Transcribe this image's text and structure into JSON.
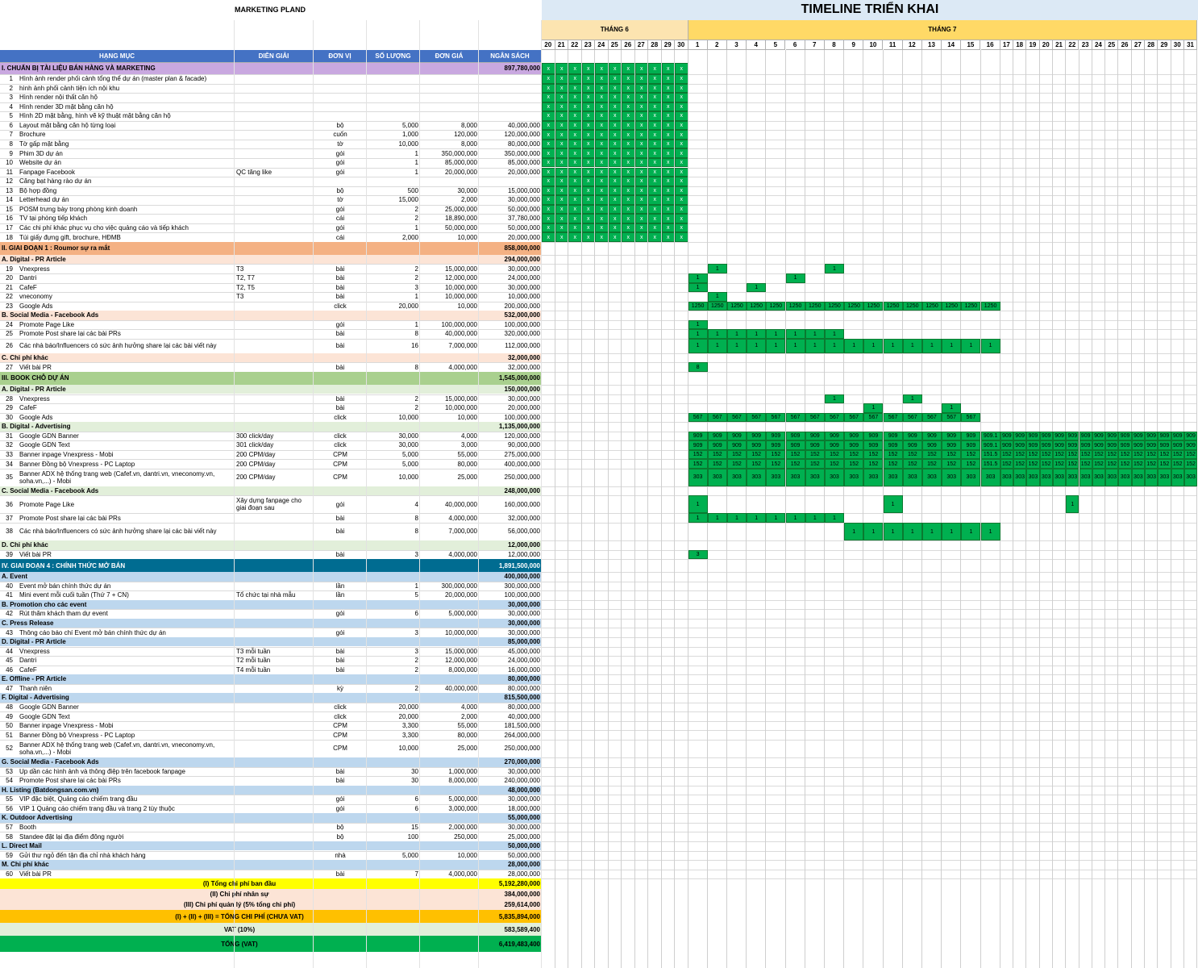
{
  "title": "MARKETING PLAND",
  "timeline_title": "TIMELINE TRIỂN KHAI",
  "months": [
    "THÁNG 6",
    "THÁNG 7"
  ],
  "june_days": [
    "20",
    "21",
    "22",
    "23",
    "24",
    "25",
    "26",
    "27",
    "28",
    "29",
    "30"
  ],
  "july_days": [
    "1",
    "2",
    "3",
    "4",
    "5",
    "6",
    "7",
    "8",
    "9",
    "10",
    "11",
    "12",
    "13",
    "14",
    "15",
    "16",
    "17",
    "18",
    "19",
    "20",
    "21",
    "22",
    "23",
    "24",
    "25",
    "26",
    "27",
    "28",
    "29",
    "30",
    "31"
  ],
  "columns": [
    "HẠNG MỤC",
    "DIỄN GIẢI",
    "ĐƠN VỊ",
    "SỐ LƯỢNG",
    "ĐƠN GIÁ",
    "NGÂN SÁCH"
  ],
  "rows": [
    {
      "t": "sec",
      "label": "I. CHUẨN BỊ TÀI LIỆU BÁN HÀNG VÀ MARKETING",
      "total": "897,780,000",
      "bg": "#c9a8e0"
    },
    {
      "t": "item",
      "no": "1",
      "name": "Hình ảnh render phối cảnh tổng thể dự án (master plan & facade)",
      "desc": "",
      "unit": "",
      "qty": "",
      "price": "",
      "total": ""
    },
    {
      "t": "item",
      "no": "2",
      "name": "hình ảnh phối cảnh tiện ích nội khu",
      "desc": "",
      "unit": "",
      "qty": "",
      "price": "",
      "total": ""
    },
    {
      "t": "item",
      "no": "3",
      "name": "Hình render nội thất căn hộ",
      "desc": "",
      "unit": "",
      "qty": "",
      "price": "",
      "total": ""
    },
    {
      "t": "item",
      "no": "4",
      "name": "Hình render 3D mặt bằng căn hộ",
      "desc": "",
      "unit": "",
      "qty": "",
      "price": "",
      "total": ""
    },
    {
      "t": "item",
      "no": "5",
      "name": "Hình 2D mặt bằng, hình vẽ kỹ thuật mặt bằng căn hộ",
      "desc": "",
      "unit": "",
      "qty": "",
      "price": "",
      "total": ""
    },
    {
      "t": "item",
      "no": "6",
      "name": "Layout mặt bằng căn hộ từng loại",
      "desc": "",
      "unit": "bộ",
      "qty": "5,000",
      "price": "8,000",
      "total": "40,000,000"
    },
    {
      "t": "item",
      "no": "7",
      "name": "Brochure",
      "desc": "",
      "unit": "cuốn",
      "qty": "1,000",
      "price": "120,000",
      "total": "120,000,000"
    },
    {
      "t": "item",
      "no": "8",
      "name": "Tờ gấp mặt bằng",
      "desc": "",
      "unit": "tờ",
      "qty": "10,000",
      "price": "8,000",
      "total": "80,000,000"
    },
    {
      "t": "item",
      "no": "9",
      "name": "Phim 3D dự án",
      "desc": "",
      "unit": "gói",
      "qty": "1",
      "price": "350,000,000",
      "total": "350,000,000"
    },
    {
      "t": "item",
      "no": "10",
      "name": "Website dự án",
      "desc": "",
      "unit": "gói",
      "qty": "1",
      "price": "85,000,000",
      "total": "85,000,000"
    },
    {
      "t": "item",
      "no": "11",
      "name": "Fanpage Facebook",
      "desc": "QC tăng like",
      "unit": "gói",
      "qty": "1",
      "price": "20,000,000",
      "total": "20,000,000"
    },
    {
      "t": "item",
      "no": "12",
      "name": "Căng bạt hàng rào dự án",
      "desc": "",
      "unit": "",
      "qty": "",
      "price": "",
      "total": ""
    },
    {
      "t": "item",
      "no": "13",
      "name": "Bộ hợp đồng",
      "desc": "",
      "unit": "bộ",
      "qty": "500",
      "price": "30,000",
      "total": "15,000,000"
    },
    {
      "t": "item",
      "no": "14",
      "name": "Letterhead dự án",
      "desc": "",
      "unit": "tờ",
      "qty": "15,000",
      "price": "2,000",
      "total": "30,000,000"
    },
    {
      "t": "item",
      "no": "15",
      "name": "POSM trưng bày trong phòng kinh doanh",
      "desc": "",
      "unit": "gói",
      "qty": "2",
      "price": "25,000,000",
      "total": "50,000,000"
    },
    {
      "t": "item",
      "no": "16",
      "name": "TV tại phòng tiếp khách",
      "desc": "",
      "unit": "cái",
      "qty": "2",
      "price": "18,890,000",
      "total": "37,780,000"
    },
    {
      "t": "item",
      "no": "17",
      "name": "Các chi phí khác phục vụ cho việc quảng cáo và tiếp khách",
      "desc": "",
      "unit": "gói",
      "qty": "1",
      "price": "50,000,000",
      "total": "50,000,000"
    },
    {
      "t": "item",
      "no": "18",
      "name": "Túi giấy đựng gift, brochure, HĐMB",
      "desc": "",
      "unit": "cái",
      "qty": "2,000",
      "price": "10,000",
      "total": "20,000,000"
    },
    {
      "t": "sec",
      "label": "II. GIAI ĐOẠN 1 : Roumor sự ra mắt",
      "total": "858,000,000",
      "bg": "#f4b183"
    },
    {
      "t": "sub",
      "label": "A. Digital - PR Article",
      "total": "294,000,000",
      "bg": "#fce4d6"
    },
    {
      "t": "item",
      "no": "19",
      "name": "Vnexpress",
      "desc": "T3",
      "unit": "bài",
      "qty": "2",
      "price": "15,000,000",
      "total": "30,000,000"
    },
    {
      "t": "item",
      "no": "20",
      "name": "Dantri",
      "desc": "T2, T7",
      "unit": "bài",
      "qty": "2",
      "price": "12,000,000",
      "total": "24,000,000"
    },
    {
      "t": "item",
      "no": "21",
      "name": "CafeF",
      "desc": "T2, T5",
      "unit": "bài",
      "qty": "3",
      "price": "10,000,000",
      "total": "30,000,000"
    },
    {
      "t": "item",
      "no": "22",
      "name": "vneconomy",
      "desc": "T3",
      "unit": "bài",
      "qty": "1",
      "price": "10,000,000",
      "total": "10,000,000"
    },
    {
      "t": "item",
      "no": "23",
      "name": "Google Ads",
      "desc": "",
      "unit": "click",
      "qty": "20,000",
      "price": "10,000",
      "total": "200,000,000"
    },
    {
      "t": "sub",
      "label": "B. Social Media - Facebook Ads",
      "total": "532,000,000",
      "bg": "#fce4d6"
    },
    {
      "t": "item",
      "no": "24",
      "name": "Promote Page Like",
      "desc": "",
      "unit": "gói",
      "qty": "1",
      "price": "100,000,000",
      "total": "100,000,000"
    },
    {
      "t": "item",
      "no": "25",
      "name": "Promote Post share lại các bài PRs",
      "desc": "",
      "unit": "bài",
      "qty": "8",
      "price": "40,000,000",
      "total": "320,000,000"
    },
    {
      "t": "item",
      "no": "26",
      "name": "Các nhà báo/Influencers có sức ảnh hưởng share lại các bài viết này",
      "desc": "",
      "unit": "bài",
      "qty": "16",
      "price": "7,000,000",
      "total": "112,000,000"
    },
    {
      "t": "sub",
      "label": "C. Chi phí khác",
      "total": "32,000,000",
      "bg": "#fce4d6"
    },
    {
      "t": "item",
      "no": "27",
      "name": "Viết bài PR",
      "desc": "",
      "unit": "bài",
      "qty": "8",
      "price": "4,000,000",
      "total": "32,000,000"
    },
    {
      "t": "sec",
      "label": "III. BOOK CHỖ DỰ ÁN",
      "total": "1,545,000,000",
      "bg": "#a9d08e"
    },
    {
      "t": "sub",
      "label": "A. Digital - PR Article",
      "total": "150,000,000",
      "bg": "#e2efda"
    },
    {
      "t": "item",
      "no": "28",
      "name": "Vnexpress",
      "desc": "",
      "unit": "bài",
      "qty": "2",
      "price": "15,000,000",
      "total": "30,000,000"
    },
    {
      "t": "item",
      "no": "29",
      "name": "CafeF",
      "desc": "",
      "unit": "bài",
      "qty": "2",
      "price": "10,000,000",
      "total": "20,000,000"
    },
    {
      "t": "item",
      "no": "30",
      "name": "Google Ads",
      "desc": "",
      "unit": "click",
      "qty": "10,000",
      "price": "10,000",
      "total": "100,000,000"
    },
    {
      "t": "sub",
      "label": "B. Digital - Advertising",
      "total": "1,135,000,000",
      "bg": "#e2efda"
    },
    {
      "t": "item",
      "no": "31",
      "name": "Google GDN Banner",
      "desc": "300 click/day",
      "unit": "click",
      "qty": "30,000",
      "price": "4,000",
      "total": "120,000,000"
    },
    {
      "t": "item",
      "no": "32",
      "name": "Google GDN Text",
      "desc": "301 click/day",
      "unit": "click",
      "qty": "30,000",
      "price": "3,000",
      "total": "90,000,000"
    },
    {
      "t": "item",
      "no": "33",
      "name": "Banner inpage Vnexpress - Mobi",
      "desc": "200 CPM/day",
      "unit": "CPM",
      "qty": "5,000",
      "price": "55,000",
      "total": "275,000,000"
    },
    {
      "t": "item",
      "no": "34",
      "name": "Banner Đồng bộ Vnexpress - PC Laptop",
      "desc": "200 CPM/day",
      "unit": "CPM",
      "qty": "5,000",
      "price": "80,000",
      "total": "400,000,000"
    },
    {
      "t": "item",
      "no": "35",
      "name": "Banner ADX hệ thống trang web (Cafef.vn, dantri.vn, vneconomy.vn, soha.vn,...) - Mobi",
      "desc": "200 CPM/day",
      "unit": "CPM",
      "qty": "10,000",
      "price": "25,000",
      "total": "250,000,000"
    },
    {
      "t": "sub",
      "label": "C. Social Media - Facebook Ads",
      "total": "248,000,000",
      "bg": "#e2efda"
    },
    {
      "t": "item",
      "no": "36",
      "name": "Promote Page Like",
      "desc": "Xây dựng fanpage cho giai đoạn sau",
      "unit": "gói",
      "qty": "4",
      "price": "40,000,000",
      "total": "160,000,000"
    },
    {
      "t": "item",
      "no": "37",
      "name": "Promote Post share lại các bài PRs",
      "desc": "",
      "unit": "bài",
      "qty": "8",
      "price": "4,000,000",
      "total": "32,000,000"
    },
    {
      "t": "item",
      "no": "38",
      "name": "Các nhà báo/Influencers có sức ảnh hưởng share lại các bài viết này",
      "desc": "",
      "unit": "bài",
      "qty": "8",
      "price": "7,000,000",
      "total": "56,000,000"
    },
    {
      "t": "sub",
      "label": "D. Chi phí khác",
      "total": "12,000,000",
      "bg": "#e2efda"
    },
    {
      "t": "item",
      "no": "39",
      "name": "Viết bài PR",
      "desc": "",
      "unit": "bài",
      "qty": "3",
      "price": "4,000,000",
      "total": "12,000,000"
    },
    {
      "t": "sec",
      "label": "IV. GIAI ĐOẠN 4 : CHÍNH THỨC MỞ BÁN",
      "total": "1,891,500,000",
      "bg": "#006c91",
      "fg": "#ffffff"
    },
    {
      "t": "sub",
      "label": "A. Event",
      "total": "400,000,000",
      "bg": "#bdd7ee"
    },
    {
      "t": "item",
      "no": "40",
      "name": "Event mở bán chính thức dự án",
      "desc": "",
      "unit": "lần",
      "qty": "1",
      "price": "300,000,000",
      "total": "300,000,000"
    },
    {
      "t": "item",
      "no": "41",
      "name": "Mini event mỗi cuối tuần (Thứ 7 + CN)",
      "desc": "Tổ chức tại nhà mẫu",
      "unit": "lần",
      "qty": "5",
      "price": "20,000,000",
      "total": "100,000,000"
    },
    {
      "t": "sub",
      "label": "B. Promotion cho các event",
      "total": "30,000,000",
      "bg": "#bdd7ee"
    },
    {
      "t": "item",
      "no": "42",
      "name": "Rút thăm khách tham dự event",
      "desc": "",
      "unit": "gói",
      "qty": "6",
      "price": "5,000,000",
      "total": "30,000,000"
    },
    {
      "t": "sub",
      "label": "C. Press Release",
      "total": "30,000,000",
      "bg": "#bdd7ee"
    },
    {
      "t": "item",
      "no": "43",
      "name": "Thông cáo báo chí Event mở bán chính thức dự án",
      "desc": "",
      "unit": "gói",
      "qty": "3",
      "price": "10,000,000",
      "total": "30,000,000"
    },
    {
      "t": "sub",
      "label": "D. Digital - PR Article",
      "total": "85,000,000",
      "bg": "#bdd7ee"
    },
    {
      "t": "item",
      "no": "44",
      "name": "Vnexpress",
      "desc": "T3 mỗi tuần",
      "unit": "bài",
      "qty": "3",
      "price": "15,000,000",
      "total": "45,000,000"
    },
    {
      "t": "item",
      "no": "45",
      "name": "Dantri",
      "desc": "T2 mỗi tuần",
      "unit": "bài",
      "qty": "2",
      "price": "12,000,000",
      "total": "24,000,000"
    },
    {
      "t": "item",
      "no": "46",
      "name": "CafeF",
      "desc": "T4 mỗi tuần",
      "unit": "bài",
      "qty": "2",
      "price": "8,000,000",
      "total": "16,000,000"
    },
    {
      "t": "sub",
      "label": "E. Offline - PR Article",
      "total": "80,000,000",
      "bg": "#bdd7ee"
    },
    {
      "t": "item",
      "no": "47",
      "name": "Thanh niên",
      "desc": "",
      "unit": "kỳ",
      "qty": "2",
      "price": "40,000,000",
      "total": "80,000,000"
    },
    {
      "t": "sub",
      "label": "F. Digital - Advertising",
      "total": "815,500,000",
      "bg": "#bdd7ee"
    },
    {
      "t": "item",
      "no": "48",
      "name": "Google GDN Banner",
      "desc": "",
      "unit": "click",
      "qty": "20,000",
      "price": "4,000",
      "total": "80,000,000"
    },
    {
      "t": "item",
      "no": "49",
      "name": "Google GDN Text",
      "desc": "",
      "unit": "click",
      "qty": "20,000",
      "price": "2,000",
      "total": "40,000,000"
    },
    {
      "t": "item",
      "no": "50",
      "name": "Banner inpage Vnexpress - Mobi",
      "desc": "",
      "unit": "CPM",
      "qty": "3,300",
      "price": "55,000",
      "total": "181,500,000"
    },
    {
      "t": "item",
      "no": "51",
      "name": "Banner Đồng bộ Vnexpress - PC Laptop",
      "desc": "",
      "unit": "CPM",
      "qty": "3,300",
      "price": "80,000",
      "total": "264,000,000"
    },
    {
      "t": "item",
      "no": "52",
      "name": "Banner ADX hệ thống trang web (Cafef.vn, dantri.vn, vneconomy.vn, soha.vn,...) - Mobi",
      "desc": "",
      "unit": "CPM",
      "qty": "10,000",
      "price": "25,000",
      "total": "250,000,000"
    },
    {
      "t": "sub",
      "label": "G. Social Media - Facebook Ads",
      "total": "270,000,000",
      "bg": "#bdd7ee"
    },
    {
      "t": "item",
      "no": "53",
      "name": "Up dần các hình ảnh và thông điệp trên facebook fanpage",
      "desc": "",
      "unit": "bài",
      "qty": "30",
      "price": "1,000,000",
      "total": "30,000,000"
    },
    {
      "t": "item",
      "no": "54",
      "name": "Promote Post share lại các bài PRs",
      "desc": "",
      "unit": "bài",
      "qty": "30",
      "price": "8,000,000",
      "total": "240,000,000"
    },
    {
      "t": "sub",
      "label": "H. Listing (Batdongsan.com.vn)",
      "total": "48,000,000",
      "bg": "#bdd7ee"
    },
    {
      "t": "item",
      "no": "55",
      "name": "VIP đặc biệt, Quảng cáo chiếm trang đầu",
      "desc": "",
      "unit": "gói",
      "qty": "6",
      "price": "5,000,000",
      "total": "30,000,000"
    },
    {
      "t": "item",
      "no": "56",
      "name": "VIP 1 Quảng cáo chiếm trang đầu và trang 2 tùy thuộc",
      "desc": "",
      "unit": "gói",
      "qty": "6",
      "price": "3,000,000",
      "total": "18,000,000"
    },
    {
      "t": "sub",
      "label": "K. Outdoor Advertising",
      "total": "55,000,000",
      "bg": "#bdd7ee"
    },
    {
      "t": "item",
      "no": "57",
      "name": "Booth",
      "desc": "",
      "unit": "bộ",
      "qty": "15",
      "price": "2,000,000",
      "total": "30,000,000"
    },
    {
      "t": "item",
      "no": "58",
      "name": "Standee đặt lại địa điểm đông người",
      "desc": "",
      "unit": "bộ",
      "qty": "100",
      "price": "250,000",
      "total": "25,000,000"
    },
    {
      "t": "sub",
      "label": "L. Direct Mail",
      "total": "50,000,000",
      "bg": "#bdd7ee"
    },
    {
      "t": "item",
      "no": "59",
      "name": "Gửi thư ngỏ đến tận địa chỉ nhà khách hàng",
      "desc": "",
      "unit": "nhà",
      "qty": "5,000",
      "price": "10,000",
      "total": "50,000,000"
    },
    {
      "t": "sub",
      "label": "M. Chi phí khác",
      "total": "28,000,000",
      "bg": "#bdd7ee"
    },
    {
      "t": "item",
      "no": "60",
      "name": "Viết bài PR",
      "desc": "",
      "unit": "bài",
      "qty": "7",
      "price": "4,000,000",
      "total": "28,000,000"
    }
  ],
  "summary": [
    {
      "label": "(I) Tổng chi phí ban đầu",
      "total": "5,192,280,000",
      "bg": "#ffff00"
    },
    {
      "label": "(II) Chi phí nhân sự",
      "total": "384,000,000",
      "bg": "#fce4d6"
    },
    {
      "label": "(III) Chi phí quản lý (5% tổng chi phí)",
      "total": "259,614,000",
      "bg": "#fce4d6"
    },
    {
      "label": "(I) + (II) + (III) = TỔNG CHI PHÍ (CHƯA VAT)",
      "total": "5,835,894,000",
      "bg": "#ffc000"
    },
    {
      "label": "VAT (10%)",
      "total": "583,589,400",
      "bg": "#e2efda"
    },
    {
      "label": "TỔNG (VAT)",
      "total": "6,419,483,400",
      "bg": "#00b050"
    }
  ],
  "schedule": {
    "prep_mark": "x",
    "r19": [
      {
        "d": "2",
        "v": "1"
      },
      {
        "d": "8",
        "v": "1"
      }
    ],
    "r20": [
      {
        "d": "1",
        "v": "1"
      },
      {
        "d": "6",
        "v": "1"
      }
    ],
    "r21": [
      {
        "d": "1",
        "v": "1"
      },
      {
        "d": "4",
        "v": "1"
      }
    ],
    "r22": [
      {
        "d": "2",
        "v": "1"
      }
    ],
    "r23": {
      "from": "1",
      "to": "16",
      "v": "1250"
    },
    "r24": [
      {
        "d": "1",
        "v": "1"
      }
    ],
    "r25": {
      "from": "1",
      "to": "8",
      "v": "1"
    },
    "r26": {
      "from": "1",
      "to": "16",
      "v": "1"
    },
    "r27": [
      {
        "d": "1",
        "v": "8"
      }
    ],
    "r28": [
      {
        "d": "8",
        "v": "1"
      },
      {
        "d": "12",
        "v": "1"
      }
    ],
    "r29": [
      {
        "d": "10",
        "v": "1"
      },
      {
        "d": "14",
        "v": "1"
      }
    ],
    "r30": {
      "from": "1",
      "to": "15",
      "v": "567"
    },
    "r31": {
      "from": "1",
      "to": "31",
      "v": "909",
      "except": {
        "16": "909.1"
      }
    },
    "r32": {
      "from": "1",
      "to": "31",
      "v": "909",
      "except": {
        "16": "909.1"
      }
    },
    "r33": {
      "from": "1",
      "to": "31",
      "v": "152",
      "except": {
        "16": "151.5"
      }
    },
    "r34": {
      "from": "1",
      "to": "31",
      "v": "152",
      "except": {
        "16": "151.5"
      }
    },
    "r35": {
      "from": "1",
      "to": "31",
      "v": "303"
    },
    "r36": [
      {
        "d": "1",
        "v": "1"
      },
      {
        "d": "11",
        "v": "1"
      },
      {
        "d": "22",
        "v": "1"
      }
    ],
    "r37": {
      "from": "1",
      "to": "8",
      "v": "1"
    },
    "r38": {
      "from": "9",
      "to": "16",
      "v": "1"
    },
    "r39": [
      {
        "d": "1",
        "v": "3"
      }
    ]
  },
  "colors": {
    "header_blue": "#4472c4",
    "june_header": "#fce4b0",
    "july_header": "#ffd966",
    "timeline_title_bg": "#dce9f5",
    "mark_green": "#00b050"
  }
}
